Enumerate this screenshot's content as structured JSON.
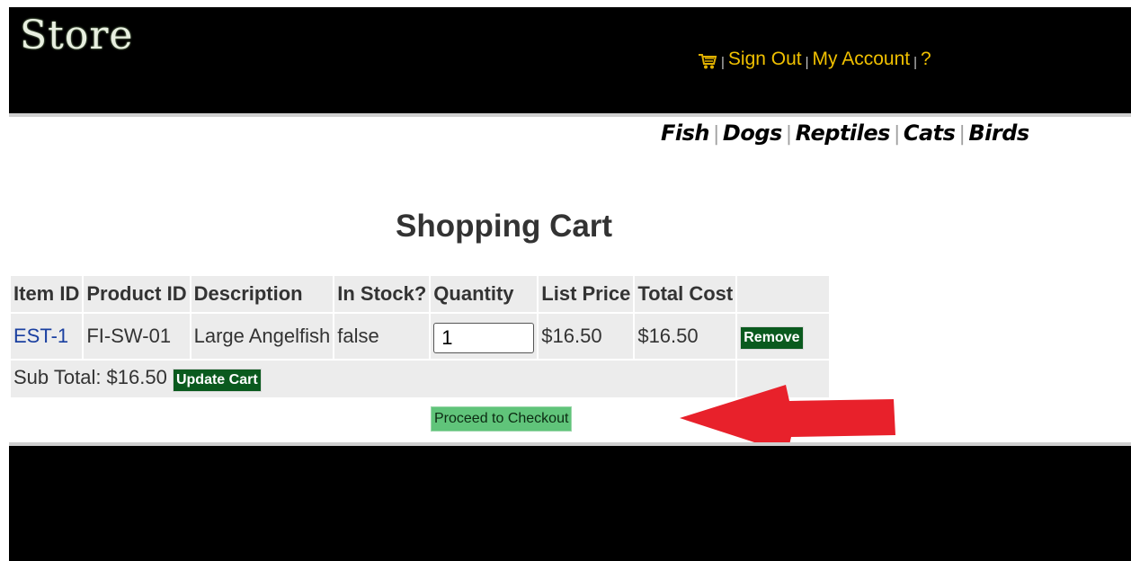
{
  "header": {
    "logo": "Store",
    "menu": {
      "cart_icon": "shopping-cart-icon",
      "sign_out": "Sign Out",
      "my_account": "My Account",
      "help": "?"
    }
  },
  "categories": [
    "Fish",
    "Dogs",
    "Reptiles",
    "Cats",
    "Birds"
  ],
  "main": {
    "title": "Shopping Cart",
    "columns": [
      "Item ID",
      "Product ID",
      "Description",
      "In Stock?",
      "Quantity",
      "List Price",
      "Total Cost"
    ],
    "rows": [
      {
        "item_id": "EST-1",
        "product_id": "FI-SW-01",
        "description": "Large Angelfish",
        "in_stock": "false",
        "quantity": "1",
        "list_price": "$16.50",
        "total_cost": "$16.50",
        "remove_label": "Remove"
      }
    ],
    "subtotal": "Sub Total: $16.50",
    "update_label": "Update Cart",
    "checkout_label": "Proceed to Checkout"
  },
  "colors": {
    "header_bg": "#000000",
    "link_yellow": "#f0c000",
    "button_green": "#0a5a1e",
    "checkout_green": "#60c47a",
    "annotation_arrow": "#e8212b"
  }
}
